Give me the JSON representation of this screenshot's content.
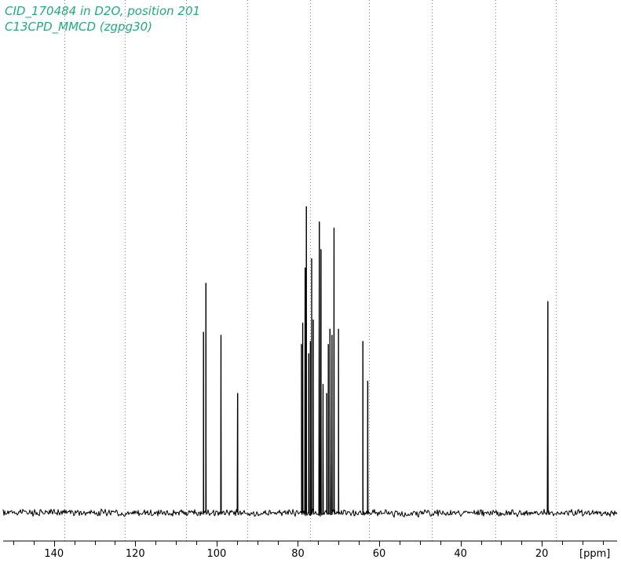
{
  "header": {
    "title_line_1": "CID_170484 in D2O, position 201",
    "title_line_2": "C13CPD_MMCD (zgpg30)"
  },
  "colors": {
    "title": "#1fae74",
    "spectrum": "#000000",
    "gridlines": "#888888",
    "background": "#ffffff"
  },
  "chart_data": {
    "type": "line",
    "title": "CID_170484 in D2O, position 201",
    "subtitle": "C13CPD_MMCD (zgpg30)",
    "xlabel": "[ppm]",
    "ylabel": "",
    "x_reversed": true,
    "xlim": [
      152.5,
      1.5
    ],
    "major_ticks": [
      140,
      120,
      100,
      80,
      60,
      40,
      20
    ],
    "tick_labels": [
      "140",
      "120",
      "100",
      "80",
      "60",
      "40",
      "20"
    ],
    "minor_tick_step": 5,
    "grid": {
      "vertical_dotted": true,
      "positions": [
        137.5,
        122.5,
        107.5,
        92.5,
        77.0,
        62.5,
        47.0,
        31.5,
        16.5
      ]
    },
    "legend": "none",
    "baseline_noise": true,
    "peaks": [
      {
        "ppm": 103.2,
        "height": 0.59
      },
      {
        "ppm": 102.6,
        "height": 0.75
      },
      {
        "ppm": 98.9,
        "height": 0.58
      },
      {
        "ppm": 94.8,
        "height": 0.39
      },
      {
        "ppm": 79.1,
        "height": 0.55
      },
      {
        "ppm": 78.8,
        "height": 0.62
      },
      {
        "ppm": 78.2,
        "height": 0.8
      },
      {
        "ppm": 77.9,
        "height": 1.0
      },
      {
        "ppm": 77.3,
        "height": 0.52
      },
      {
        "ppm": 76.9,
        "height": 0.56
      },
      {
        "ppm": 76.6,
        "height": 0.83
      },
      {
        "ppm": 76.2,
        "height": 0.63
      },
      {
        "ppm": 74.7,
        "height": 0.95
      },
      {
        "ppm": 74.3,
        "height": 0.86
      },
      {
        "ppm": 73.8,
        "height": 0.42
      },
      {
        "ppm": 72.9,
        "height": 0.39
      },
      {
        "ppm": 72.5,
        "height": 0.55
      },
      {
        "ppm": 72.1,
        "height": 0.6
      },
      {
        "ppm": 71.6,
        "height": 0.58
      },
      {
        "ppm": 71.1,
        "height": 0.93
      },
      {
        "ppm": 70.0,
        "height": 0.6
      },
      {
        "ppm": 64.0,
        "height": 0.56
      },
      {
        "ppm": 62.8,
        "height": 0.43
      },
      {
        "ppm": 18.5,
        "height": 0.69
      }
    ]
  }
}
